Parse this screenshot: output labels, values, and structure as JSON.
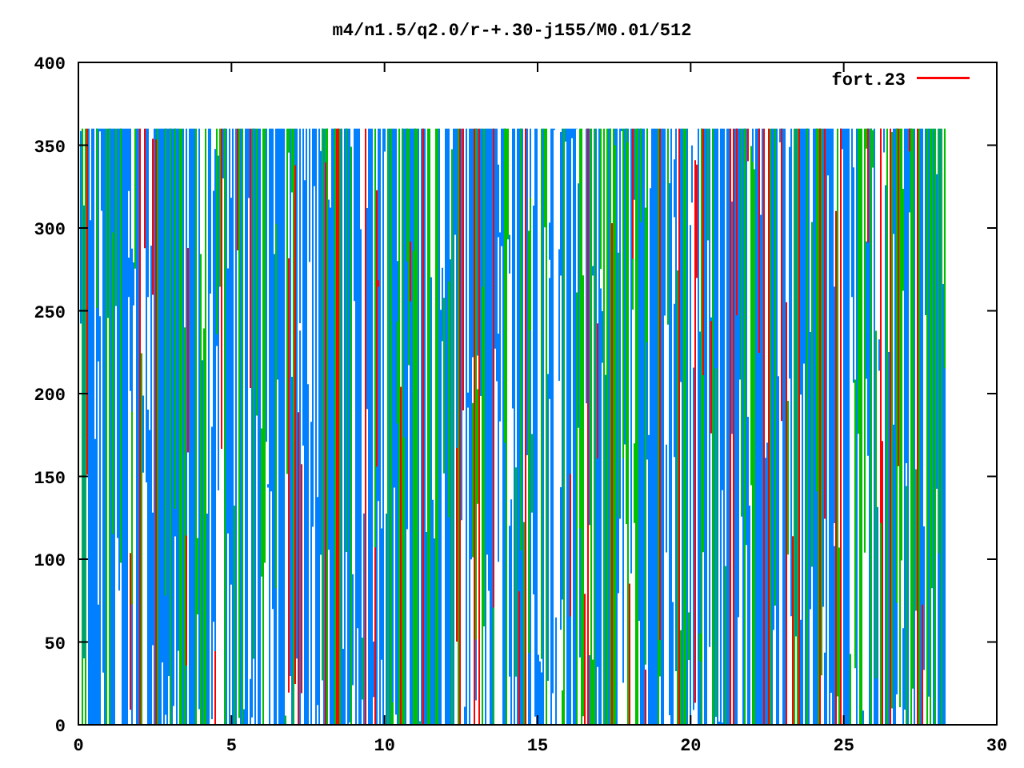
{
  "plot": {
    "title": "m4/n1.5/q2.0/r-+.30-j155/M0.01/512",
    "y_tick_labels": [
      "400",
      "350",
      "300",
      "250",
      "200",
      "150",
      "100",
      "50",
      "0"
    ],
    "x_tick_labels": [
      "0",
      "5",
      "10",
      "15",
      "20",
      "25",
      "30"
    ],
    "legend": {
      "label": "fort.23",
      "color": "#ff0000"
    }
  }
}
